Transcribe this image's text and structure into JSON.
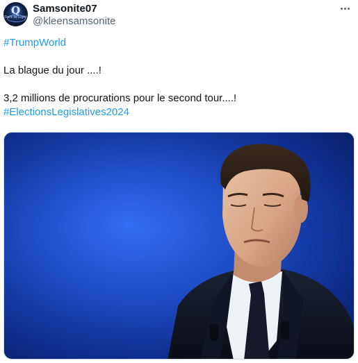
{
  "tweet": {
    "author": {
      "display_name": "Samsonite07",
      "handle": "@kleensamsonite",
      "avatar_letter": "Q",
      "avatar_caption": "Dark to Light"
    },
    "lines": {
      "hashtag1": "#TrumpWorld",
      "line2": "La blague du jour ....!",
      "line3": "3,2 millions de procurations pour le second tour....!",
      "hashtag2": "#ElectionsLegislatives2024"
    },
    "colors": {
      "link": "#1d9bf0",
      "text": "#0f1419",
      "muted": "#536471",
      "photo_background": "#1e4fd0"
    },
    "icons": {
      "more": "more-horizontal-icon"
    }
  }
}
